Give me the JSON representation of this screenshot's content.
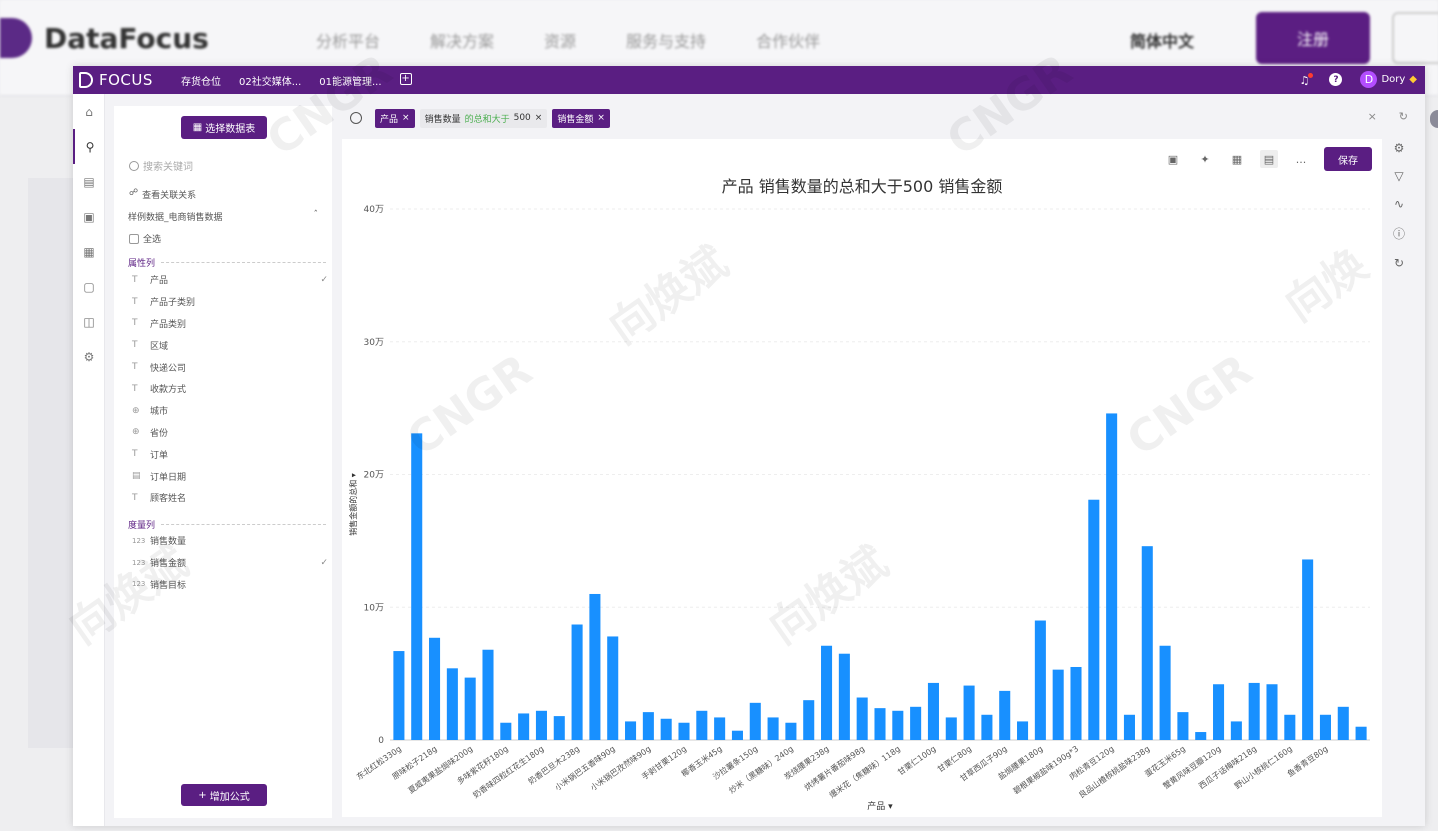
{
  "background_site": {
    "brand": "DataFocus",
    "nav": [
      "分析平台",
      "解决方案",
      "资源",
      "服务与支持",
      "合作伙伴"
    ],
    "language": "简体中文",
    "register": "注册"
  },
  "topbar": {
    "brand": "FOCUS",
    "tabs": [
      "存货仓位",
      "02社交媒体...",
      "01能源管理..."
    ],
    "add_tab": "+",
    "user_initial": "D",
    "user_name": "Dory"
  },
  "panel": {
    "choose_table": "选择数据表",
    "search_placeholder": "搜索关键词",
    "view_relations": "查看关联关系",
    "source_name": "样例数据_电商销售数据",
    "select_all": "全选",
    "attribute_section": "属性列",
    "attributes": [
      {
        "name": "产品",
        "type": "T",
        "checked": true
      },
      {
        "name": "产品子类别",
        "type": "T",
        "checked": false
      },
      {
        "name": "产品类别",
        "type": "T",
        "checked": false
      },
      {
        "name": "区域",
        "type": "T",
        "checked": false
      },
      {
        "name": "快递公司",
        "type": "T",
        "checked": false
      },
      {
        "name": "收款方式",
        "type": "T",
        "checked": false
      },
      {
        "name": "城市",
        "type": "globe",
        "checked": false
      },
      {
        "name": "省份",
        "type": "globe",
        "checked": false
      },
      {
        "name": "订单",
        "type": "T",
        "checked": false
      },
      {
        "name": "订单日期",
        "type": "date",
        "checked": false
      },
      {
        "name": "顾客姓名",
        "type": "T",
        "checked": false
      }
    ],
    "measure_section": "度量列",
    "measures": [
      {
        "name": "销售数量",
        "type": "123",
        "checked": false
      },
      {
        "name": "销售金额",
        "type": "123",
        "checked": true
      },
      {
        "name": "销售目标",
        "type": "123",
        "checked": false
      }
    ],
    "add_formula": "增加公式"
  },
  "searchbar": {
    "tokens": [
      {
        "text": "产品",
        "style": "dark"
      },
      {
        "prefix": "销售数量",
        "highlight": "的总和大于",
        "suffix": "500",
        "style": "light"
      },
      {
        "text": "销售金额",
        "style": "dark"
      }
    ]
  },
  "chart_toolbar": {
    "save": "保存",
    "more": "..."
  },
  "chart_data": {
    "type": "bar",
    "title": "产品 销售数量的总和大于500 销售金额",
    "xlabel": "产品",
    "ylabel": "销售金额的总和",
    "ylim": [
      0,
      400000
    ],
    "yticks": [
      0,
      100000,
      200000,
      300000,
      400000
    ],
    "ytick_labels": [
      "0",
      "10万",
      "20万",
      "30万",
      "40万"
    ],
    "color": "#1890ff",
    "categories": [
      "东北红松330g",
      "",
      "原味松子218g",
      "",
      "夏威夷果盐焗味200g",
      "",
      "多味紫花籽180g",
      "",
      "奶香味四粒红花生180g",
      "",
      "奶香巴旦木238g",
      "",
      "小米锅巴五香味90g",
      "",
      "小米锅巴孜然味90g",
      "",
      "手剥甘栗120g",
      "",
      "椰香玉米45g",
      "",
      "沙拉薯条150g",
      "",
      "炒米（黑糖味）240g",
      "",
      "炭烧腰果238g",
      "",
      "烘烤薯片番茄味98g",
      "",
      "爆米花（焦糖味）118g",
      "",
      "甘栗仁100g",
      "",
      "甘栗仁80g",
      "",
      "甘草西瓜子90g",
      "",
      "盐焗腰果180g",
      "",
      "碧根果椒盐味190g*3",
      "",
      "肉松青豆120g",
      "",
      "良品山楂核桃盐味238g",
      "",
      "蛋花玉米65g",
      "",
      "蟹黄风味豆瓣120g",
      "",
      "西瓜子话梅味218g",
      "",
      "野山小核桃仁160g",
      "",
      "鱼香青豆80g",
      ""
    ],
    "values": [
      67000,
      231000,
      77000,
      54000,
      47000,
      68000,
      13000,
      20000,
      22000,
      18000,
      87000,
      110000,
      78000,
      14000,
      21000,
      16000,
      13000,
      22000,
      17000,
      7000,
      28000,
      17000,
      13000,
      30000,
      71000,
      65000,
      32000,
      24000,
      22000,
      25000,
      43000,
      17000,
      41000,
      19000,
      37000,
      14000,
      90000,
      53000,
      55000,
      181000,
      246000,
      19000,
      146000,
      71000,
      21000,
      6000,
      42000,
      14000,
      43000,
      42000,
      19000,
      136000,
      19000,
      25000,
      10000
    ]
  }
}
